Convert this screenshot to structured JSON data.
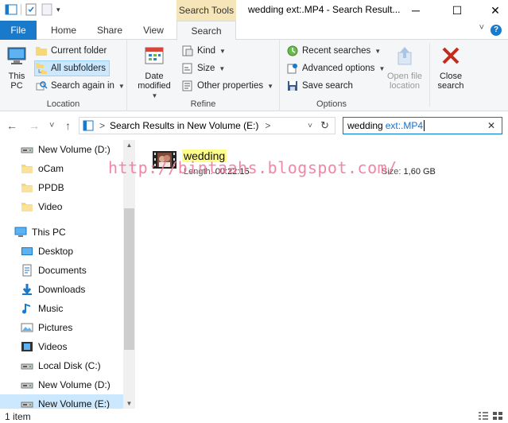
{
  "window": {
    "title": "wedding ext:.MP4 - Search Result...",
    "contextual_tab_label": "Search Tools",
    "minimize": "─",
    "maximize": "☐",
    "close": "✕"
  },
  "tabs": {
    "file": "File",
    "home": "Home",
    "share": "Share",
    "view": "View",
    "search": "Search",
    "collapse": "˅",
    "help": "?"
  },
  "ribbon": {
    "location": {
      "label": "Location",
      "this_pc": "This PC",
      "current_folder": "Current folder",
      "all_subfolders": "All subfolders",
      "search_again_in": "Search again in"
    },
    "refine": {
      "label": "Refine",
      "date_modified_line1": "Date",
      "date_modified_line2": "modified",
      "kind": "Kind",
      "size": "Size",
      "other_properties": "Other properties"
    },
    "options": {
      "label": "Options",
      "recent_searches": "Recent searches",
      "advanced_options": "Advanced options",
      "save_search": "Save search",
      "open_file_location_line1": "Open file",
      "open_file_location_line2": "location",
      "close_search_line1": "Close",
      "close_search_line2": "search"
    }
  },
  "address": {
    "back": "←",
    "forward": "→",
    "recent": "˅",
    "up": "↑",
    "crumb_sep": ">",
    "path": "Search Results in New Volume (E:)",
    "trail_sep": ">",
    "refresh": "↻"
  },
  "search": {
    "query_term": "wedding",
    "query_filter": "ext:.MP4",
    "clear": "✕"
  },
  "nav": {
    "items": [
      {
        "label": "New Volume (D:)",
        "icon": "drive-icon"
      },
      {
        "label": "oCam",
        "icon": "folder-icon"
      },
      {
        "label": "PPDB",
        "icon": "folder-icon"
      },
      {
        "label": "Video",
        "icon": "folder-icon"
      },
      {
        "label": "This PC",
        "icon": "computer-icon"
      },
      {
        "label": "Desktop",
        "icon": "desktop-icon"
      },
      {
        "label": "Documents",
        "icon": "documents-icon"
      },
      {
        "label": "Downloads",
        "icon": "downloads-icon"
      },
      {
        "label": "Music",
        "icon": "music-icon"
      },
      {
        "label": "Pictures",
        "icon": "pictures-icon"
      },
      {
        "label": "Videos",
        "icon": "videos-icon"
      },
      {
        "label": "Local Disk (C:)",
        "icon": "drive-icon"
      },
      {
        "label": "New Volume (D:)",
        "icon": "drive-icon"
      },
      {
        "label": "New Volume (E:)",
        "icon": "drive-icon"
      }
    ],
    "scroll_up": "▲",
    "scroll_down": "▼"
  },
  "results": [
    {
      "name": "wedding",
      "length_label": "Length:",
      "length": "00:22:15",
      "size_label": "Size:",
      "size": "1,60 GB"
    }
  ],
  "watermark": "http://bintaahs.blogspot.com/",
  "status": {
    "count": "1 item"
  },
  "colors": {
    "accent": "#1979ca",
    "selection": "#cce8ff",
    "contextual_tab": "#f6e5b9",
    "highlight": "#fdfd8c",
    "watermark": "#f07a9d"
  }
}
